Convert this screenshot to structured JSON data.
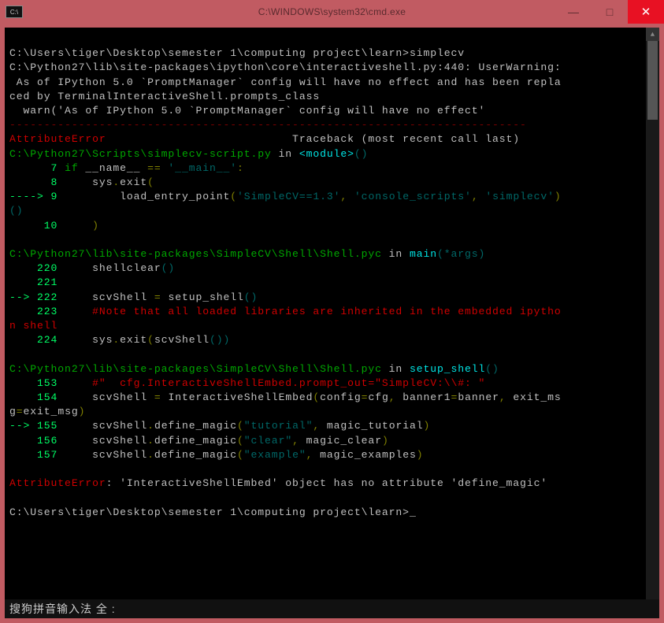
{
  "window": {
    "title": "C:\\WINDOWS\\system32\\cmd.exe",
    "sysicon_label": "C:\\",
    "btn_min": "—",
    "btn_max": "□",
    "btn_close": "✕"
  },
  "ime": {
    "text": "搜狗拼音输入法  全  :"
  },
  "prompt1": {
    "path": "C:\\Users\\tiger\\Desktop\\semester 1\\computing project\\learn>",
    "cmd": "simplecv"
  },
  "warn": {
    "l1": "C:\\Python27\\lib\\site-packages\\ipython\\core\\interactiveshell.py:440: UserWarning:",
    "l2": " As of IPython 5.0 `PromptManager` config will have no effect and has been repla",
    "l3": "ced by TerminalInteractiveShell.prompts_class",
    "l4": "  warn('As of IPython 5.0 `PromptManager` config will have no effect'"
  },
  "sep": "---------------------------------------------------------------------------",
  "err_head": {
    "name": "AttributeError",
    "rest": "                           Traceback (most recent call last)"
  },
  "frame1": {
    "path": "C:\\Python27\\Scripts\\simplecv-script.py",
    "in": " in ",
    "mod": "<module>",
    "parens": "()",
    "l7a": "      7 ",
    "l7b": "if",
    "l7c": " __name__ ",
    "l7d": "==",
    "l7e": " '__main__'",
    "l7f": ":",
    "l8a": "      8 ",
    "l8b": "    sys",
    "l8c": ".",
    "l8d": "exit",
    "l8e": "(",
    "l9a": "----> 9",
    "l9b": "         load_entry_point",
    "l9c": "(",
    "l9d": "'SimpleCV==1.3'",
    "l9e": ",",
    "l9f": " 'console_scripts'",
    "l9g": ",",
    "l9h": " 'simplecv'",
    "l9i": ")",
    "l9_2a": "()",
    "l10a": "     10 ",
    "l10b": "    ",
    "l10c": ")"
  },
  "frame2": {
    "path": "C:\\Python27\\lib\\site-packages\\SimpleCV\\Shell\\Shell.pyc",
    "in": " in ",
    "fn": "main",
    "args_open": "(",
    "args": "*args",
    "args_close": ")",
    "l220a": "    220 ",
    "l220b": "    shellclear",
    "l220c": "()",
    "l221a": "    221 ",
    "l222a": "--> 222",
    "l222b": "     scvShell ",
    "l222c": "=",
    "l222d": " setup_shell",
    "l222e": "()",
    "l223a": "    223 ",
    "l223b": "    #Note that all loaded libraries are inherited in the embedded ipytho",
    "l223_2": "n shell",
    "l224a": "    224 ",
    "l224b": "    sys",
    "l224c": ".",
    "l224d": "exit",
    "l224e": "(",
    "l224f": "scvShell",
    "l224g": "())"
  },
  "frame3": {
    "path": "C:\\Python27\\lib\\site-packages\\SimpleCV\\Shell\\Shell.pyc",
    "in": " in ",
    "fn": "setup_shell",
    "parens": "()",
    "l153a": "    153 ",
    "l153b": "    #\"  cfg.InteractiveShellEmbed.prompt_out=\"SimpleCV:\\\\#: \"",
    "l154a": "    154 ",
    "l154b": "    scvShell ",
    "l154c": "=",
    "l154d": " InteractiveShellEmbed",
    "l154e": "(",
    "l154f": "config",
    "l154g": "=",
    "l154h": "cfg",
    "l154i": ",",
    "l154j": " banner1",
    "l154k": "=",
    "l154l": "banner",
    "l154m": ",",
    "l154n": " exit_ms",
    "l154_2a": "g",
    "l154_2b": "=",
    "l154_2c": "exit_msg",
    "l154_2d": ")",
    "l155a": "--> 155",
    "l155b": "     scvShell",
    "l155c": ".",
    "l155d": "define_magic",
    "l155e": "(",
    "l155f": "\"tutorial\"",
    "l155g": ",",
    "l155h": " magic_tutorial",
    "l155i": ")",
    "l156a": "    156 ",
    "l156b": "    scvShell",
    "l156c": ".",
    "l156d": "define_magic",
    "l156e": "(",
    "l156f": "\"clear\"",
    "l156g": ",",
    "l156h": " magic_clear",
    "l156i": ")",
    "l157a": "    157 ",
    "l157b": "    scvShell",
    "l157c": ".",
    "l157d": "define_magic",
    "l157e": "(",
    "l157f": "\"example\"",
    "l157g": ",",
    "l157h": " magic_examples",
    "l157i": ")"
  },
  "err_final": {
    "name": "AttributeError",
    "rest": ": 'InteractiveShellEmbed' object has no attribute 'define_magic'"
  },
  "prompt2": {
    "path": "C:\\Users\\tiger\\Desktop\\semester 1\\computing project\\learn>",
    "cursor": "_"
  }
}
